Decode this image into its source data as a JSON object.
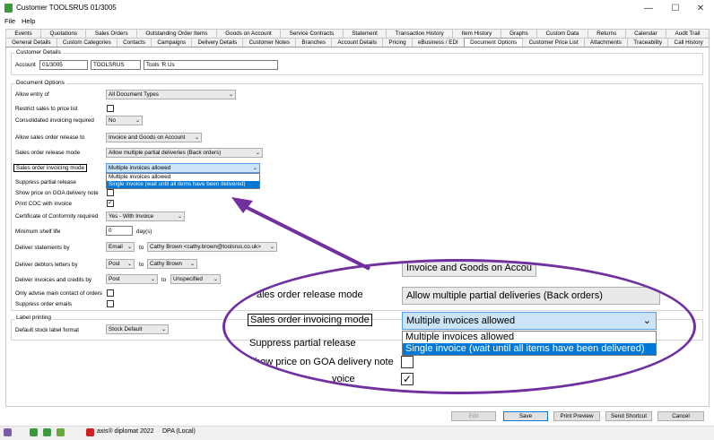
{
  "window": {
    "title": "Customer TOOLSRUS 01/3005",
    "minimize": "—",
    "maximize": "☐",
    "close": "✕"
  },
  "menu": [
    "File",
    "Help"
  ],
  "tabs_row1": [
    "Events",
    "Quotations",
    "Sales Orders",
    "Outstanding Order Items",
    "Goods on Account",
    "Service Contracts",
    "Statement",
    "Transaction History",
    "Item History",
    "Graphs",
    "Custom Data",
    "Returns",
    "Calendar",
    "Audit Trail"
  ],
  "tabs_row2": [
    "General Details",
    "Custom Categories",
    "Contacts",
    "Campaigns",
    "Delivery Details",
    "Customer Notes",
    "Branches",
    "Account Details",
    "Pricing",
    "eBusiness / EDI",
    "Document Options",
    "Customer Price List",
    "Attachments",
    "Traceability",
    "Call History"
  ],
  "active_tab": "Document Options",
  "customer_details": {
    "title": "Customer Details",
    "account_label": "Account",
    "account_number": "01/3005",
    "account_code": "TOOLSRUS",
    "account_name": "Tools 'R Us"
  },
  "document_options": {
    "title": "Document Options",
    "allow_entry_label": "Allow entry of",
    "allow_entry_value": "All Document Types",
    "restrict_label": "Restrict sales to price list",
    "consolidated_label": "Consolidated invoicing required",
    "consolidated_value": "No",
    "allow_release_label": "Allow sales order release to",
    "allow_release_value": "Invoice and Goods on Account",
    "release_mode_label": "Sales order release mode",
    "release_mode_value": "Allow multiple partial deliveries (Back orders)",
    "invoicing_mode_label": "Sales order invoicing mode",
    "invoicing_mode_value": "Multiple invoices allowed",
    "invoicing_options": [
      "Multiple invoices allowed",
      "Single invoice (wait until all items have been delivered)"
    ],
    "suppress_partial_label": "Suppress partial release",
    "show_price_label": "Show price on GOA delivery note",
    "print_coc_label": "Print COC with invoice",
    "certificate_label": "Certificate of Conformity required",
    "certificate_value": "Yes - With Invoice",
    "min_shelf_label": "Minimum shelf life",
    "min_shelf_value": "0",
    "min_shelf_unit": "day(s)",
    "deliver_statements_label": "Deliver statements by",
    "deliver_statements_method": "Email",
    "to_label": "to",
    "deliver_statements_to": "Cathy Brown <cathy.brown@toolsrus.co.uk>",
    "deliver_debtors_label": "Deliver debtors letters by",
    "deliver_debtors_method": "Post",
    "deliver_debtors_to": "Cathy Brown",
    "deliver_invoices_label": "Deliver invoices and credits by",
    "deliver_invoices_method": "Post",
    "deliver_invoices_to": "Unspecified",
    "only_advise_label": "Only advise main contact of orders",
    "suppress_emails_label": "Suppress order emails"
  },
  "label_printing": {
    "title": "Label printing",
    "default_label": "Default stock label format",
    "default_value": "Stock Default"
  },
  "buttons": {
    "edit": "Edit",
    "save": "Save",
    "print_preview": "Print Preview",
    "send_shortcut": "Send Shortcut",
    "cancel": "Cancel"
  },
  "status": {
    "app": "axis® diplomat 2022",
    "db": "DPA (Local)"
  },
  "zoom": {
    "partial_top_value": "Invoice and Goods on Accou",
    "release_mode_label": "ales order release mode",
    "show_price_label": "how price on GOA delivery note",
    "print_coc_label": "voice"
  },
  "colors": {
    "accent": "#0078d7",
    "callout": "#7030a0"
  }
}
